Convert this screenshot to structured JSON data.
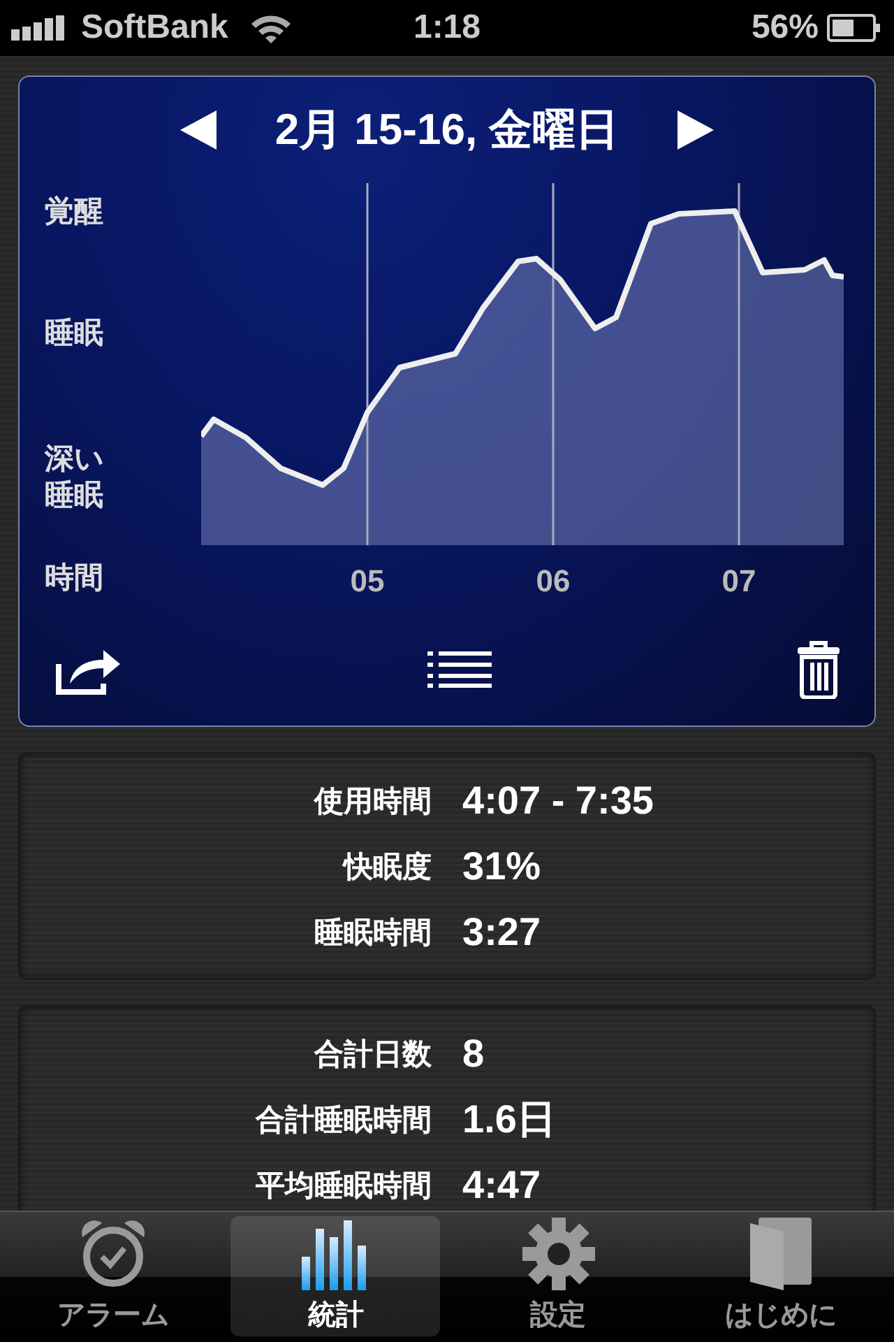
{
  "status_bar": {
    "carrier": "SoftBank",
    "time": "1:18",
    "battery": "56%"
  },
  "sleep_card": {
    "title": "2月 15-16, 金曜日",
    "y_labels": [
      "覚醒",
      "睡眠",
      "深い睡眠"
    ],
    "x_axis_label": "時間",
    "x_labels": [
      "05",
      "06",
      "07"
    ]
  },
  "session_stats": [
    {
      "label": "使用時間",
      "value": "4:07 - 7:35"
    },
    {
      "label": "快眠度",
      "value": "31%"
    },
    {
      "label": "睡眠時間",
      "value": "3:27"
    }
  ],
  "total_stats": [
    {
      "label": "合計日数",
      "value": "8"
    },
    {
      "label": "合計睡眠時間",
      "value": "1.6日"
    },
    {
      "label": "平均睡眠時間",
      "value": "4:47"
    }
  ],
  "tabs": [
    {
      "kind": "alarm",
      "label": "アラーム",
      "selected": false
    },
    {
      "kind": "stats",
      "label": "統計",
      "selected": true
    },
    {
      "kind": "settings",
      "label": "設定",
      "selected": false
    },
    {
      "kind": "guide",
      "label": "はじめに",
      "selected": false
    }
  ]
}
